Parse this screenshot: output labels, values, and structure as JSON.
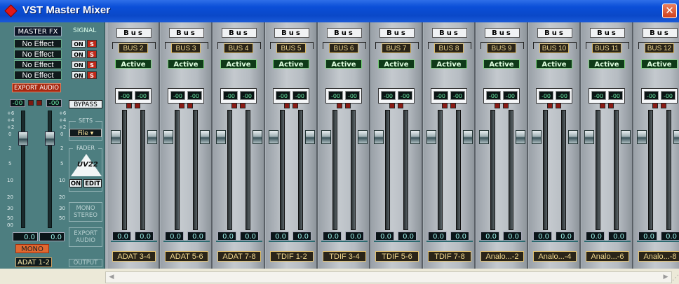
{
  "window": {
    "title": "VST Master Mixer",
    "close_glyph": "✕"
  },
  "master": {
    "fx_title": "MASTER FX",
    "fx_slots": [
      "No Effect",
      "No Effect",
      "No Effect",
      "No Effect"
    ],
    "export_audio_top": "EXPORT AUDIO",
    "signal_label": "SIGNAL",
    "on_labels": [
      "ON",
      "ON",
      "ON",
      "ON"
    ],
    "s_labels": [
      "S",
      "S",
      "S",
      "S"
    ],
    "peak_left": "-00",
    "peak_right": "-00",
    "bypass": "BYPASS",
    "sets_label": "SETS",
    "file_select": "File",
    "fader_label": "FADER",
    "logo_text": "UV22",
    "on_button": "ON",
    "edit_button": "EDIT",
    "mono_stereo": "MONO STEREO",
    "export_audio": "EXPORT AUDIO",
    "output_label": "OUTPUT",
    "scale_marks": [
      "+6",
      "+4",
      "+2",
      "0",
      "2",
      "5",
      "10",
      "20",
      "30",
      "50",
      "00"
    ],
    "value_left": "0.0",
    "value_right": "0.0",
    "mono_button": "MONO",
    "output": "ADAT 1-2"
  },
  "channels": [
    {
      "bus_label": "Bus",
      "bus": "BUS 2",
      "status": "Active",
      "peak_l": "-00",
      "peak_r": "-00",
      "val_l": "0.0",
      "val_r": "0.0",
      "output": "ADAT 3-4"
    },
    {
      "bus_label": "Bus",
      "bus": "BUS 3",
      "status": "Active",
      "peak_l": "-00",
      "peak_r": "-00",
      "val_l": "0.0",
      "val_r": "0.0",
      "output": "ADAT 5-6"
    },
    {
      "bus_label": "Bus",
      "bus": "BUS 4",
      "status": "Active",
      "peak_l": "-00",
      "peak_r": "-00",
      "val_l": "0.0",
      "val_r": "0.0",
      "output": "ADAT 7-8"
    },
    {
      "bus_label": "Bus",
      "bus": "BUS 5",
      "status": "Active",
      "peak_l": "-00",
      "peak_r": "-00",
      "val_l": "0.0",
      "val_r": "0.0",
      "output": "TDIF 1-2"
    },
    {
      "bus_label": "Bus",
      "bus": "BUS 6",
      "status": "Active",
      "peak_l": "-00",
      "peak_r": "-00",
      "val_l": "0.0",
      "val_r": "0.0",
      "output": "TDIF 3-4"
    },
    {
      "bus_label": "Bus",
      "bus": "BUS 7",
      "status": "Active",
      "peak_l": "-00",
      "peak_r": "-00",
      "val_l": "0.0",
      "val_r": "0.0",
      "output": "TDIF 5-6"
    },
    {
      "bus_label": "Bus",
      "bus": "BUS 8",
      "status": "Active",
      "peak_l": "-00",
      "peak_r": "-00",
      "val_l": "0.0",
      "val_r": "0.0",
      "output": "TDIF 7-8"
    },
    {
      "bus_label": "Bus",
      "bus": "BUS 9",
      "status": "Active",
      "peak_l": "-00",
      "peak_r": "-00",
      "val_l": "0.0",
      "val_r": "0.0",
      "output": "Analo...-2"
    },
    {
      "bus_label": "Bus",
      "bus": "BUS 10",
      "status": "Active",
      "peak_l": "-00",
      "peak_r": "-00",
      "val_l": "0.0",
      "val_r": "0.0",
      "output": "Analo...-4"
    },
    {
      "bus_label": "Bus",
      "bus": "BUS 11",
      "status": "Active",
      "peak_l": "-00",
      "peak_r": "-00",
      "val_l": "0.0",
      "val_r": "0.0",
      "output": "Analo...-6"
    },
    {
      "bus_label": "Bus",
      "bus": "BUS 12",
      "status": "Active",
      "peak_l": "-00",
      "peak_r": "-00",
      "val_l": "0.0",
      "val_r": "0.0",
      "output": "Analo...-8"
    }
  ],
  "scrollbar": {
    "left_arrow": "◀",
    "right_arrow": "▶"
  }
}
